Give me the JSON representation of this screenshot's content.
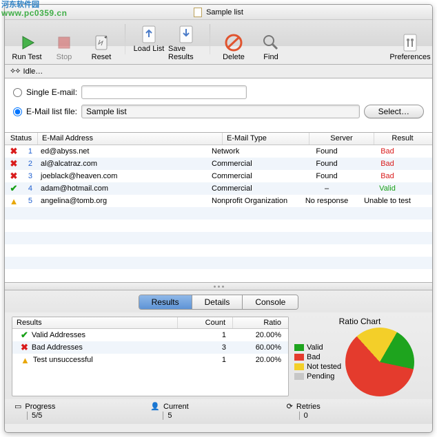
{
  "watermark": {
    "line1": "河东软件园",
    "line2": "www.pc0359.cn"
  },
  "window": {
    "title": "Sample list"
  },
  "toolbar": {
    "run_test": "Run Test",
    "stop": "Stop",
    "reset": "Reset",
    "load_list": "Load List",
    "save_results": "Save Results",
    "delete": "Delete",
    "find": "Find",
    "preferences": "Preferences"
  },
  "status": {
    "state": "Idle…"
  },
  "source": {
    "single_label": "Single E-mail:",
    "single_value": "",
    "file_label": "E-Mail list file:",
    "file_value": "Sample list",
    "select_btn": "Select…"
  },
  "table": {
    "headers": {
      "status": "Status",
      "email": "E-Mail Address",
      "type": "E-Mail Type",
      "server": "Server",
      "result": "Result"
    },
    "rows": [
      {
        "n": 1,
        "status": "bad",
        "email": "ed@abyss.net",
        "type": "Network",
        "server": "Found",
        "result": "Bad",
        "result_class": "bad"
      },
      {
        "n": 2,
        "status": "bad",
        "email": "al@alcatraz.com",
        "type": "Commercial",
        "server": "Found",
        "result": "Bad",
        "result_class": "bad"
      },
      {
        "n": 3,
        "status": "bad",
        "email": "joeblack@heaven.com",
        "type": "Commercial",
        "server": "Found",
        "result": "Bad",
        "result_class": "bad"
      },
      {
        "n": 4,
        "status": "valid",
        "email": "adam@hotmail.com",
        "type": "Commercial",
        "server": "–",
        "result": "Valid",
        "result_class": "valid"
      },
      {
        "n": 5,
        "status": "warn",
        "email": "angelina@tomb.org",
        "type": "Nonprofit Organization",
        "server": "No response",
        "result": "Unable to test",
        "result_class": ""
      }
    ]
  },
  "tabs": {
    "results": "Results",
    "details": "Details",
    "console": "Console"
  },
  "results_table": {
    "headers": {
      "results": "Results",
      "count": "Count",
      "ratio": "Ratio"
    },
    "rows": [
      {
        "icon": "valid",
        "label": "Valid Addresses",
        "count": 1,
        "ratio": "20.00%"
      },
      {
        "icon": "bad",
        "label": "Bad Addresses",
        "count": 3,
        "ratio": "60.00%"
      },
      {
        "icon": "warn",
        "label": "Test unsuccessful",
        "count": 1,
        "ratio": "20.00%"
      }
    ]
  },
  "chart_data": {
    "title": "Ratio Chart",
    "type": "pie",
    "slices": [
      {
        "name": "Valid",
        "value": 20,
        "color": "#1ea41e"
      },
      {
        "name": "Bad",
        "value": 60,
        "color": "#e43b2d"
      },
      {
        "name": "Not tested",
        "value": 20,
        "color": "#f3cf29"
      },
      {
        "name": "Pending",
        "value": 0,
        "color": "#c7c7c7"
      }
    ],
    "legend": [
      "Valid",
      "Bad",
      "Not tested",
      "Pending"
    ]
  },
  "metrics": {
    "progress_label": "Progress",
    "progress_val": "5/5",
    "current_label": "Current",
    "current_val": "5",
    "retries_label": "Retries",
    "retries_val": "0"
  }
}
